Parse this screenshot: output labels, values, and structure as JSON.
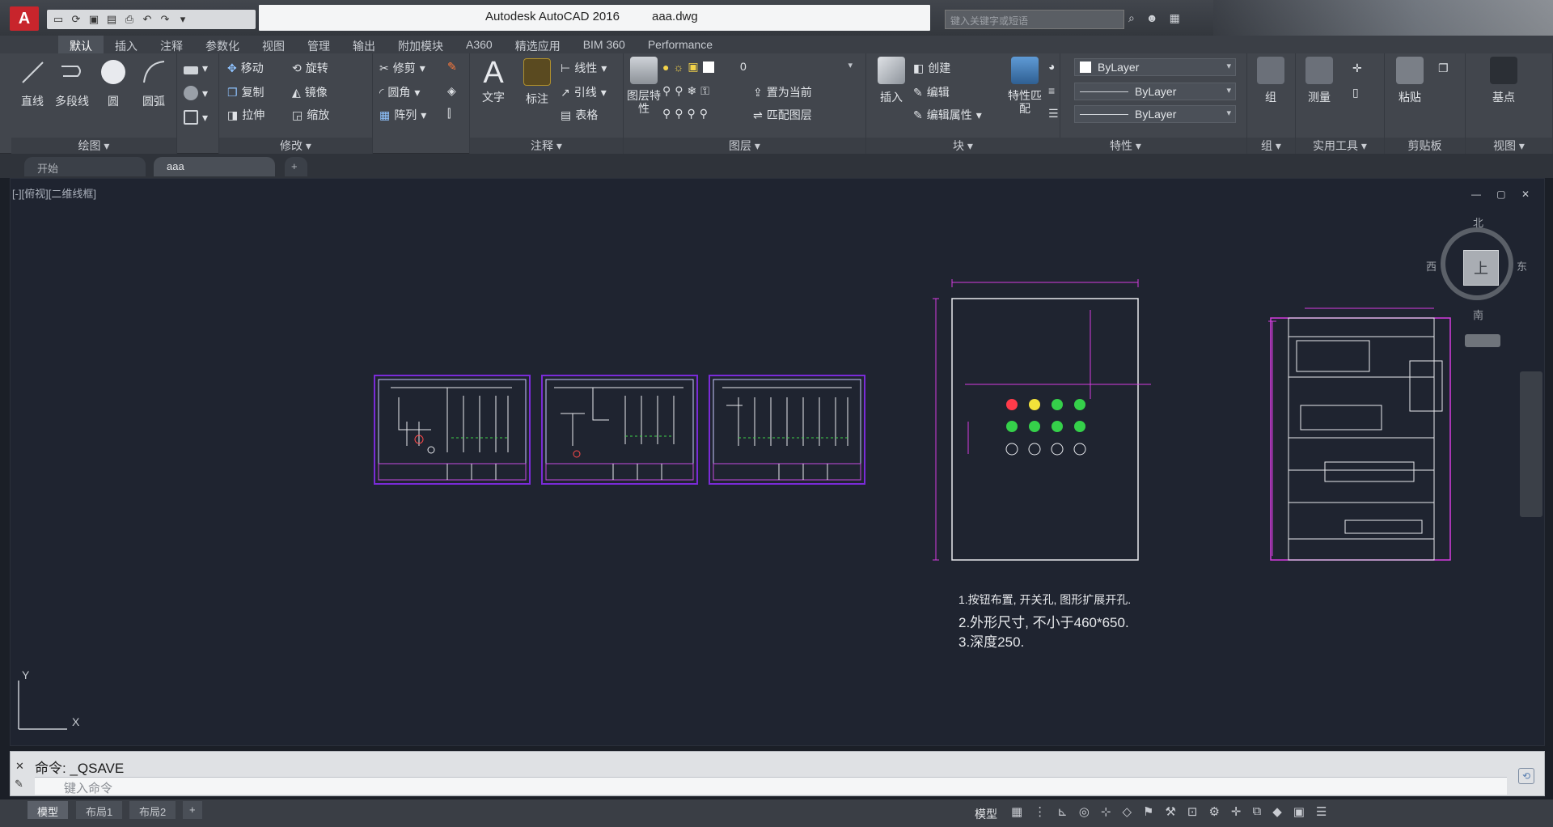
{
  "title": {
    "app": "Autodesk AutoCAD 2016",
    "file": "aaa.dwg",
    "search_placeholder": "键入关键字或短语"
  },
  "tabs": [
    "默认",
    "插入",
    "注释",
    "参数化",
    "视图",
    "管理",
    "输出",
    "附加模块",
    "A360",
    "精选应用",
    "BIM 360",
    "Performance"
  ],
  "ribbon": {
    "draw": {
      "title": "绘图",
      "line": "直线",
      "polyline": "多段线",
      "circle": "圆",
      "arc": "圆弧"
    },
    "modify": {
      "title": "修改",
      "move": "移动",
      "rotate": "旋转",
      "trim": "修剪",
      "copy": "复制",
      "mirror": "镜像",
      "fillet": "圆角",
      "stretch": "拉伸",
      "scale": "缩放",
      "array": "阵列"
    },
    "annotation": {
      "title": "注释",
      "text": "文字",
      "dimension": "标注",
      "linear": "线性",
      "leader": "引线",
      "table": "表格"
    },
    "layers": {
      "title": "图层",
      "properties": "图层特性",
      "layer_value": "0",
      "make_current": "置为当前",
      "match_layer": "匹配图层"
    },
    "block": {
      "title": "块",
      "insert": "插入",
      "create": "创建",
      "edit": "编辑",
      "edit_attributes": "编辑属性"
    },
    "properties": {
      "title": "特性",
      "match": "特性匹配",
      "color": "ByLayer",
      "linetype": "ByLayer",
      "lineweight": "ByLayer"
    },
    "groups": {
      "title": "组",
      "group": "组"
    },
    "utilities": {
      "title": "实用工具",
      "measure": "测量"
    },
    "clipboard": {
      "title": "剪贴板",
      "paste": "粘贴"
    },
    "view": {
      "title": "视图",
      "base": "基点"
    }
  },
  "doc_tabs": [
    "开始",
    "aaa"
  ],
  "viewport_label": "[-][俯视][二维线框]",
  "notes": [
    "1.按钮布置, 开关孔, 图形扩展开孔.",
    "2.外形尺寸, 不小于460*650.",
    "3.深度250."
  ],
  "viewcube": {
    "top": "北",
    "left": "西",
    "right": "东",
    "bottom": "南",
    "face": "上"
  },
  "command": {
    "history": "命令:  _QSAVE",
    "placeholder": "键入命令"
  },
  "status": {
    "layout_tabs": [
      "模型",
      "布局1",
      "布局2"
    ],
    "model": "模型"
  },
  "colors": {
    "frame": "#7a2bd8",
    "wire": "#e8eaee",
    "accent": "#c8252c"
  }
}
